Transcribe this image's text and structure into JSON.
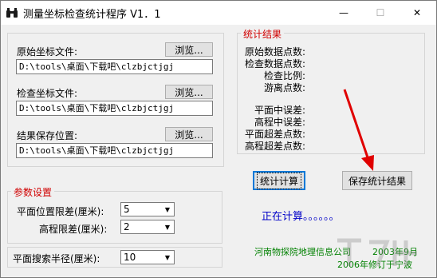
{
  "window": {
    "title": "测量坐标检查统计程序 V1．1",
    "controls": {
      "minimize": "—",
      "maximize": "☐",
      "close": "✕"
    }
  },
  "files": {
    "original_label": "原始坐标文件:",
    "check_label": "检查坐标文件:",
    "result_label": "结果保存位置:",
    "browse_label": "浏览...",
    "original_path": "D:\\tools\\桌面\\下载吧\\clzbjctjgj",
    "check_path": "D:\\tools\\桌面\\下载吧\\clzbjctjgj",
    "result_path": "D:\\tools\\桌面\\下载吧\\clzbjctjgj"
  },
  "params": {
    "legend": "参数设置",
    "plane_limit_label": "平面位置限差(厘米):",
    "plane_limit_value": "5",
    "height_limit_label": "高程限差(厘米):",
    "height_limit_value": "2",
    "search_radius_label": "平面搜索半径(厘米):",
    "search_radius_value": "10"
  },
  "stats": {
    "legend": "统计结果",
    "labels": [
      "原始数据点数:",
      "检查数据点数:",
      "检查比例:",
      "游离点数:",
      "平面中误差:",
      "高程中误差:",
      "平面超差点数:",
      "高程超差点数:"
    ]
  },
  "actions": {
    "compute_label": "统计计算",
    "save_label": "保存统计结果"
  },
  "status_text": "正在计算。。。。。。",
  "credits": {
    "company": "河南物探院地理信息公司",
    "date": "2003年9月",
    "revision": "2006年修订于宁波"
  },
  "colors": {
    "legend": "#d00000",
    "status": "#0000c8",
    "credit": "#008000",
    "annotation_arrow": "#e00000"
  }
}
